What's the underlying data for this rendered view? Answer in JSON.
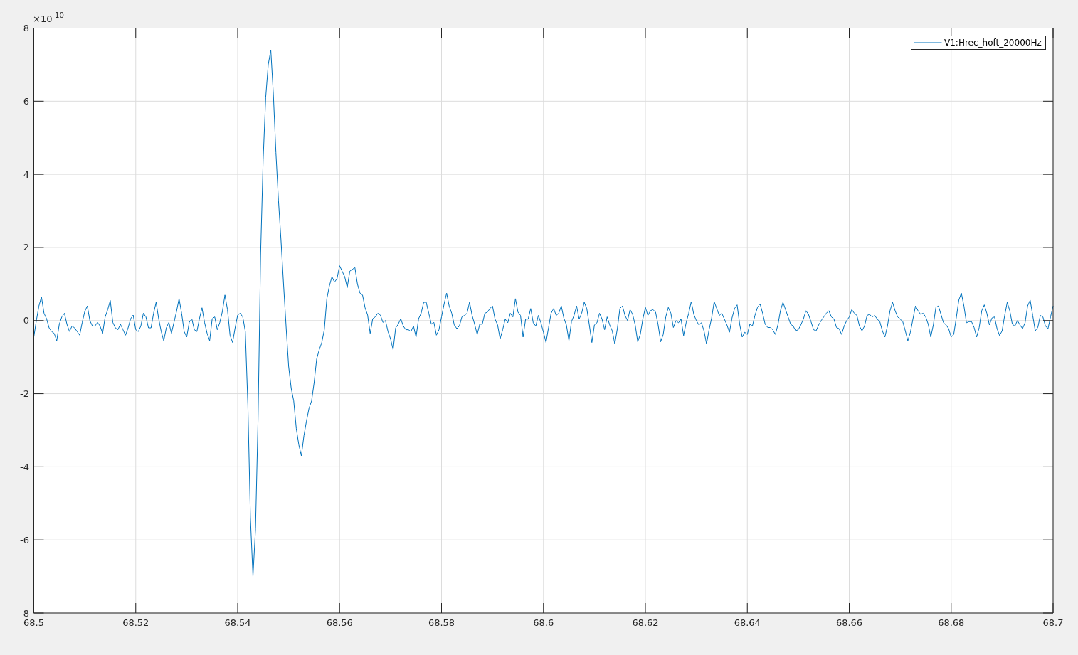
{
  "figure": {
    "axis_exponent": "×10$^{-10}$",
    "chart_data": {
      "type": "line",
      "grid": true,
      "xlim": [
        68.5,
        68.7
      ],
      "ylim": [
        -8,
        8
      ],
      "xticks": [
        68.5,
        68.52,
        68.54,
        68.56,
        68.58,
        68.6,
        68.62,
        68.64,
        68.66,
        68.68,
        68.7
      ],
      "yticks": [
        -8,
        -6,
        -4,
        -2,
        0,
        2,
        4,
        6,
        8
      ],
      "x": [
        68.5,
        68.5005,
        68.501,
        68.5015,
        68.502,
        68.5025,
        68.503,
        68.5035,
        68.504,
        68.5045,
        68.505,
        68.5055,
        68.506,
        68.5065,
        68.507,
        68.5075,
        68.508,
        68.5085,
        68.509,
        68.5095,
        68.51,
        68.5105,
        68.511,
        68.5115,
        68.512,
        68.5125,
        68.513,
        68.5135,
        68.514,
        68.5145,
        68.515,
        68.5155,
        68.516,
        68.5165,
        68.517,
        68.5175,
        68.518,
        68.5185,
        68.519,
        68.5195,
        68.52,
        68.5205,
        68.521,
        68.5215,
        68.522,
        68.5225,
        68.523,
        68.5235,
        68.524,
        68.5245,
        68.525,
        68.5255,
        68.526,
        68.5265,
        68.527,
        68.5275,
        68.528,
        68.5285,
        68.529,
        68.5295,
        68.53,
        68.5305,
        68.531,
        68.5315,
        68.532,
        68.5325,
        68.533,
        68.5335,
        68.534,
        68.5345,
        68.535,
        68.5355,
        68.536,
        68.5365,
        68.537,
        68.5375,
        68.538,
        68.5385,
        68.539,
        68.5395,
        68.54,
        68.5405,
        68.541,
        68.5415,
        68.542,
        68.5425,
        68.543,
        68.5435,
        68.544,
        68.5445,
        68.545,
        68.5455,
        68.546,
        68.5465,
        68.547,
        68.5475,
        68.548,
        68.5485,
        68.549,
        68.5495,
        68.55,
        68.5505,
        68.551,
        68.5515,
        68.552,
        68.5525,
        68.553,
        68.5535,
        68.554,
        68.5545,
        68.555,
        68.5555,
        68.556,
        68.5565,
        68.557,
        68.5575,
        68.558,
        68.5585,
        68.559,
        68.5595,
        68.56,
        68.5605,
        68.561,
        68.5615,
        68.562,
        68.5625,
        68.563,
        68.5635,
        68.564,
        68.5645,
        68.565,
        68.5655,
        68.566,
        68.5665,
        68.567,
        68.5675,
        68.568,
        68.5685,
        68.569,
        68.5695,
        68.57,
        68.5705,
        68.571,
        68.5715,
        68.572,
        68.5725,
        68.573,
        68.5735,
        68.574,
        68.5745,
        68.575,
        68.5755,
        68.576,
        68.5765,
        68.577,
        68.5775,
        68.578,
        68.5785,
        68.579,
        68.5795,
        68.58,
        68.5805,
        68.581,
        68.5815,
        68.582,
        68.5825,
        68.583,
        68.5835,
        68.584,
        68.5845,
        68.585,
        68.5855,
        68.586,
        68.5865,
        68.587,
        68.5875,
        68.588,
        68.5885,
        68.589,
        68.5895,
        68.59,
        68.5905,
        68.591,
        68.5915,
        68.592,
        68.5925,
        68.593,
        68.5935,
        68.594,
        68.5945,
        68.595,
        68.5955,
        68.596,
        68.5965,
        68.597,
        68.5975,
        68.598,
        68.5985,
        68.599,
        68.5995,
        68.6,
        68.6005,
        68.601,
        68.6015,
        68.602,
        68.6025,
        68.603,
        68.6035,
        68.604,
        68.6045,
        68.605,
        68.6055,
        68.606,
        68.6065,
        68.607,
        68.6075,
        68.608,
        68.6085,
        68.609,
        68.6095,
        68.61,
        68.6105,
        68.611,
        68.6115,
        68.612,
        68.6125,
        68.613,
        68.6135,
        68.614,
        68.6145,
        68.615,
        68.6155,
        68.616,
        68.6165,
        68.617,
        68.6175,
        68.618,
        68.6185,
        68.619,
        68.6195,
        68.62,
        68.6205,
        68.621,
        68.6215,
        68.622,
        68.6225,
        68.623,
        68.6235,
        68.624,
        68.6245,
        68.625,
        68.6255,
        68.626,
        68.6265,
        68.627,
        68.6275,
        68.628,
        68.6285,
        68.629,
        68.6295,
        68.63,
        68.6305,
        68.631,
        68.6315,
        68.632,
        68.6325,
        68.633,
        68.6335,
        68.634,
        68.6345,
        68.635,
        68.6355,
        68.636,
        68.6365,
        68.637,
        68.6375,
        68.638,
        68.6385,
        68.639,
        68.6395,
        68.64,
        68.6405,
        68.641,
        68.6415,
        68.642,
        68.6425,
        68.643,
        68.6435,
        68.644,
        68.6445,
        68.645,
        68.6455,
        68.646,
        68.6465,
        68.647,
        68.6475,
        68.648,
        68.6485,
        68.649,
        68.6495,
        68.65,
        68.6505,
        68.651,
        68.6515,
        68.652,
        68.6525,
        68.653,
        68.6535,
        68.654,
        68.6545,
        68.655,
        68.6555,
        68.656,
        68.6565,
        68.657,
        68.6575,
        68.658,
        68.6585,
        68.659,
        68.6595,
        68.66,
        68.6605,
        68.661,
        68.6615,
        68.662,
        68.6625,
        68.663,
        68.6635,
        68.664,
        68.6645,
        68.665,
        68.6655,
        68.666,
        68.6665,
        68.667,
        68.6675,
        68.668,
        68.6685,
        68.669,
        68.6695,
        68.67,
        68.6705,
        68.671,
        68.6715,
        68.672,
        68.6725,
        68.673,
        68.6735,
        68.674,
        68.6745,
        68.675,
        68.6755,
        68.676,
        68.6765,
        68.677,
        68.6775,
        68.678,
        68.6785,
        68.679,
        68.6795,
        68.68,
        68.6805,
        68.681,
        68.6815,
        68.682,
        68.6825,
        68.683,
        68.6835,
        68.684,
        68.6845,
        68.685,
        68.6855,
        68.686,
        68.6865,
        68.687,
        68.6875,
        68.688,
        68.6885,
        68.689,
        68.6895,
        68.69,
        68.6905,
        68.691,
        68.6915,
        68.692,
        68.6925,
        68.693,
        68.6935,
        68.694,
        68.6945,
        68.695,
        68.6955,
        68.696,
        68.6965,
        68.697,
        68.6975,
        68.698,
        68.6985,
        68.699,
        68.6995,
        68.7
      ],
      "series": [
        {
          "name": "V1:Hrec_hoft_20000Hz",
          "color": "#0072bd",
          "values": [
            -0.45,
            0,
            0.4,
            0.65,
            0.2,
            0.05,
            -0.2,
            -0.3,
            -0.35,
            -0.55,
            -0.1,
            0.1,
            0.2,
            -0.1,
            -0.3,
            -0.15,
            -0.2,
            -0.3,
            -0.4,
            -0.05,
            0.25,
            0.4,
            0,
            -0.15,
            -0.15,
            -0.05,
            -0.15,
            -0.35,
            0.1,
            0.3,
            0.55,
            -0.05,
            -0.2,
            -0.25,
            -0.1,
            -0.25,
            -0.4,
            -0.2,
            0.05,
            0.15,
            -0.25,
            -0.3,
            -0.15,
            0.2,
            0.1,
            -0.2,
            -0.2,
            0.2,
            0.5,
            0.05,
            -0.3,
            -0.55,
            -0.2,
            -0.05,
            -0.35,
            -0.05,
            0.25,
            0.6,
            0.2,
            -0.3,
            -0.45,
            -0.05,
            0.05,
            -0.25,
            -0.3,
            0.05,
            0.35,
            -0.05,
            -0.35,
            -0.55,
            0.05,
            0.1,
            -0.25,
            -0.05,
            0.25,
            0.7,
            0.3,
            -0.4,
            -0.6,
            -0.2,
            0.15,
            0.2,
            0.1,
            -0.3,
            -2.3,
            -5.4,
            -7,
            -5.7,
            -2.7,
            1.8,
            4.4,
            6.1,
            7,
            7.4,
            6.2,
            4.6,
            3.3,
            2.2,
            1,
            -0.16,
            -1.25,
            -1.85,
            -2.2,
            -2.95,
            -3.4,
            -3.7,
            -3.15,
            -2.75,
            -2.4,
            -2.2,
            -1.7,
            -1.05,
            -0.8,
            -0.6,
            -0.25,
            0.6,
            0.95,
            1.2,
            1.05,
            1.15,
            1.5,
            1.35,
            1.2,
            0.9,
            1.35,
            1.4,
            1.45,
            1,
            0.75,
            0.7,
            0.35,
            0.15,
            -0.35,
            0.05,
            0.1,
            0.2,
            0.15,
            -0.05,
            0,
            -0.3,
            -0.5,
            -0.8,
            -0.2,
            -0.1,
            0.05,
            -0.15,
            -0.25,
            -0.25,
            -0.3,
            -0.15,
            -0.45,
            0.05,
            0.2,
            0.5,
            0.5,
            0.2,
            -0.1,
            -0.05,
            -0.4,
            -0.25,
            0.1,
            0.45,
            0.75,
            0.4,
            0.2,
            -0.12,
            -0.22,
            -0.15,
            0.1,
            0.14,
            0.2,
            0.5,
            0.14,
            -0.1,
            -0.38,
            -0.1,
            -0.1,
            0.2,
            0.23,
            0.33,
            0.4,
            0.04,
            -0.12,
            -0.5,
            -0.25,
            0.04,
            -0.06,
            0.2,
            0.1,
            0.6,
            0.23,
            0.14,
            -0.45,
            0.04,
            0.04,
            0.33,
            -0.06,
            -0.15,
            0.14,
            -0.06,
            -0.32,
            -0.6,
            -0.19,
            0.2,
            0.33,
            0.14,
            0.2,
            0.4,
            0.07,
            -0.12,
            -0.55,
            -0.03,
            0.14,
            0.4,
            0.04,
            0.2,
            0.5,
            0.33,
            -0.12,
            -0.6,
            -0.12,
            -0.06,
            0.2,
            0.04,
            -0.25,
            0.1,
            -0.12,
            -0.28,
            -0.64,
            -0.22,
            0.33,
            0.4,
            0.14,
            0,
            0.3,
            0.17,
            -0.12,
            -0.58,
            -0.38,
            0.04,
            0.36,
            0.14,
            0.27,
            0.3,
            0.23,
            -0.12,
            -0.58,
            -0.38,
            0.1,
            0.36,
            0.2,
            -0.19,
            0,
            -0.06,
            0.04,
            -0.41,
            -0.06,
            0.2,
            0.52,
            0.17,
            0,
            -0.12,
            -0.06,
            -0.28,
            -0.64,
            -0.25,
            0.07,
            0.52,
            0.33,
            0.14,
            0.2,
            0.04,
            -0.12,
            -0.32,
            0.07,
            0.33,
            0.43,
            -0.1,
            -0.45,
            -0.32,
            -0.38,
            -0.1,
            -0.15,
            0.14,
            0.36,
            0.46,
            0.2,
            -0.1,
            -0.19,
            -0.19,
            -0.25,
            -0.38,
            -0.12,
            0.27,
            0.5,
            0.3,
            0.1,
            -0.1,
            -0.15,
            -0.28,
            -0.25,
            -0.12,
            0.04,
            0.27,
            0.17,
            -0.03,
            -0.25,
            -0.28,
            -0.12,
            0,
            0.1,
            0.2,
            0.27,
            0.1,
            0.04,
            -0.19,
            -0.22,
            -0.38,
            -0.15,
            0,
            0.1,
            0.3,
            0.2,
            0.14,
            -0.15,
            -0.28,
            -0.15,
            0.14,
            0.17,
            0.1,
            0.14,
            0.04,
            -0.03,
            -0.28,
            -0.45,
            -0.15,
            0.27,
            0.5,
            0.27,
            0.1,
            0.04,
            -0.03,
            -0.28,
            -0.55,
            -0.32,
            0.04,
            0.4,
            0.27,
            0.17,
            0.2,
            0.1,
            -0.1,
            -0.45,
            -0.12,
            0.36,
            0.4,
            0.17,
            -0.06,
            -0.12,
            -0.22,
            -0.45,
            -0.38,
            0.07,
            0.56,
            0.75,
            0.4,
            -0.06,
            -0.03,
            -0.03,
            -0.19,
            -0.45,
            -0.19,
            0.27,
            0.43,
            0.2,
            -0.12,
            0.07,
            0.1,
            -0.22,
            -0.41,
            -0.28,
            0.14,
            0.5,
            0.27,
            -0.1,
            -0.15,
            0,
            -0.12,
            -0.22,
            -0.06,
            0.4,
            0.56,
            0.14,
            -0.28,
            -0.19,
            0.14,
            0.1,
            -0.15,
            -0.22,
            0.1,
            0.4
          ]
        }
      ]
    }
  }
}
